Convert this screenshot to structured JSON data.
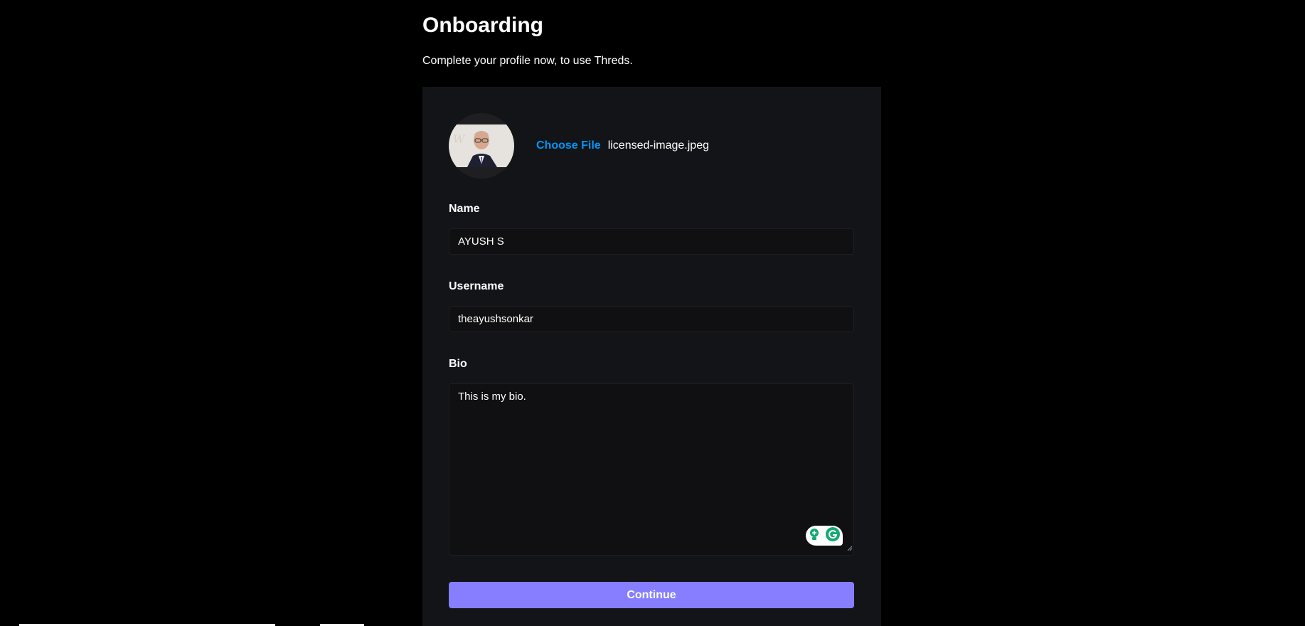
{
  "header": {
    "title": "Onboarding",
    "subtitle": "Complete your profile now, to use Threds."
  },
  "profile_photo": {
    "choose_file_label": "Choose File",
    "file_name": "licensed-image.jpeg"
  },
  "form": {
    "name": {
      "label": "Name",
      "value": "AYUSH S"
    },
    "username": {
      "label": "Username",
      "value": "theayushsonkar"
    },
    "bio": {
      "label": "Bio",
      "value": "This is my bio."
    },
    "submit_label": "Continue"
  },
  "colors": {
    "background": "#000000",
    "card": "#121417",
    "input": "#101012",
    "link": "#0095f6",
    "primary": "#877eff"
  },
  "icons": {
    "grammarly_add": "grammarly-lightbulb-icon",
    "grammarly_logo": "grammarly-g-icon"
  }
}
